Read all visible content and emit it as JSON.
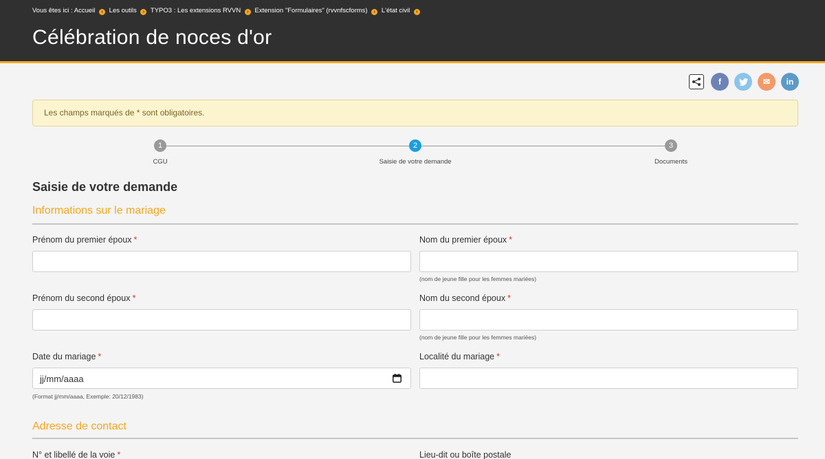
{
  "breadcrumb": {
    "prefix": "Vous êtes ici :",
    "items": [
      "Accueil",
      "Les outils",
      "TYPO3 : Les extensions RVVN",
      "Extension \"Formulaires\" (rvvnfscforms)",
      "L'état civil"
    ]
  },
  "page": {
    "title": "Célébration de noces d'or"
  },
  "share": {
    "icons": [
      "share-icon",
      "facebook-icon",
      "twitter-icon",
      "email-icon",
      "linkedin-icon"
    ],
    "facebook_glyph": "f",
    "twitter_glyph": "t",
    "email_glyph": "✉",
    "linkedin_glyph": "in",
    "colors": {
      "facebook": "#6d83b6",
      "twitter": "#8cc4ea",
      "email": "#f3996a",
      "linkedin": "#5d9ac7"
    }
  },
  "alert": {
    "text": "Les champs marqués de * sont obligatoires."
  },
  "stepper": {
    "steps": [
      {
        "number": "1",
        "label": "CGU",
        "state": "done"
      },
      {
        "number": "2",
        "label": "Saisie de votre demande",
        "state": "active"
      },
      {
        "number": "3",
        "label": "Documents",
        "state": "todo"
      }
    ]
  },
  "form": {
    "heading": "Saisie de votre demande",
    "required_marker": "*",
    "sections": {
      "marriage": {
        "title": "Informations sur le mariage"
      },
      "contact": {
        "title": "Adresse de contact"
      }
    },
    "fields": {
      "first_spouse_firstname": {
        "label": "Prénom du premier époux",
        "value": "",
        "required": true
      },
      "first_spouse_lastname": {
        "label": "Nom du premier époux",
        "value": "",
        "required": true,
        "help": "(nom de jeune fille pour les femmes mariées)"
      },
      "second_spouse_firstname": {
        "label": "Prénom du second époux",
        "value": "",
        "required": true
      },
      "second_spouse_lastname": {
        "label": "Nom du second époux",
        "value": "",
        "required": true,
        "help": "(nom de jeune fille pour les femmes mariées)"
      },
      "marriage_date": {
        "label": "Date du mariage",
        "placeholder": "jj/mm/aaaa",
        "required": true,
        "help": "(Format jj/mm/aaaa, Exemple: 20/12/1983)"
      },
      "marriage_locality": {
        "label": "Localité du mariage",
        "value": "",
        "required": true
      },
      "street": {
        "label": "N° et libellé de la voie",
        "required": true
      },
      "locality_box": {
        "label": "Lieu-dit ou boîte postale",
        "required": false
      }
    }
  },
  "colors": {
    "accent": "#f5a623",
    "active_step": "#1a9ee0",
    "header_bg": "#303030",
    "required": "#d9352a"
  }
}
